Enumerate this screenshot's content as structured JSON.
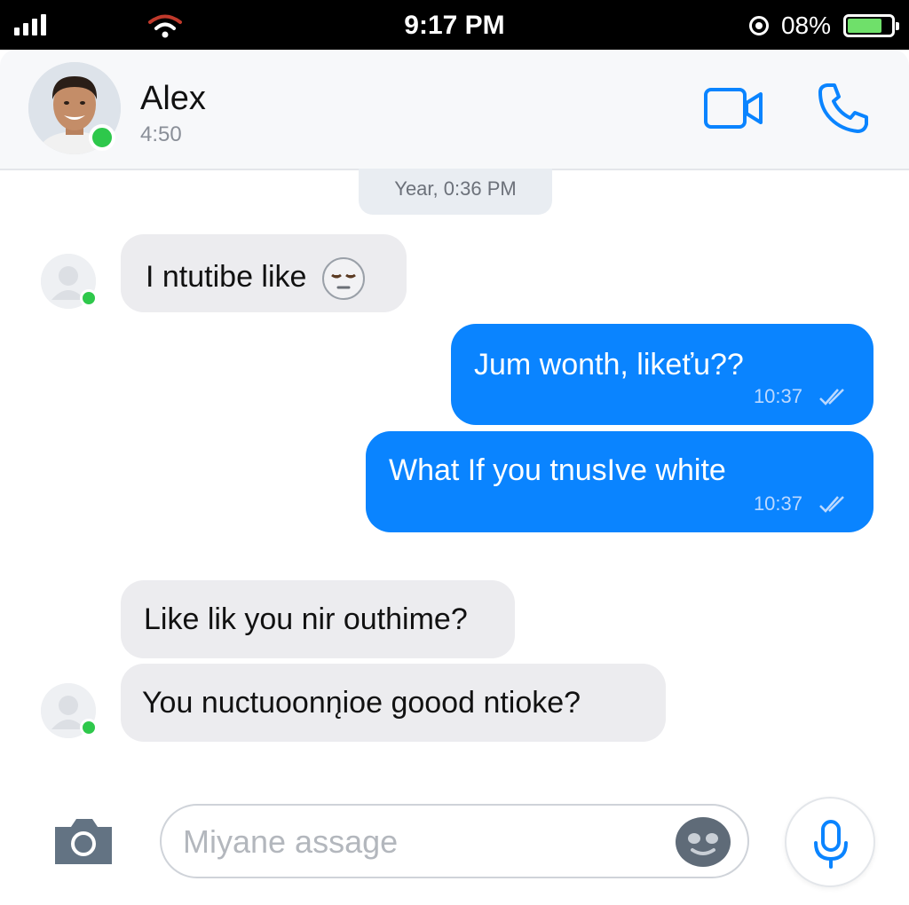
{
  "status_bar": {
    "time": "9:17 PM",
    "battery_percent_label": "08%",
    "battery_level": 0.08,
    "icons": [
      "signal-icon",
      "wifi-icon",
      "rotation-lock-icon",
      "battery-icon"
    ]
  },
  "header": {
    "contact_name": "Alex",
    "contact_sub": "4:50",
    "online": true,
    "icons": [
      "video-call-icon",
      "phone-call-icon"
    ]
  },
  "date_separator": "Year, 0:36 PM",
  "messages": [
    {
      "direction": "incoming",
      "text": "I ntutibe like",
      "emoji": "sleepy-face-emoji"
    },
    {
      "direction": "outgoing",
      "text": "Jum wonth, likeťu??",
      "time": "10:37",
      "status": "read"
    },
    {
      "direction": "outgoing",
      "text": "What If you tnusIve white",
      "time": "10:37",
      "status": "read"
    },
    {
      "direction": "incoming",
      "text": "Like lik you nir outhime?"
    },
    {
      "direction": "incoming",
      "text": "You nuctuoonn̨ioe goood ntioke?"
    }
  ],
  "composer": {
    "placeholder": "Miyane assage",
    "icons": [
      "camera-icon",
      "emoji-icon",
      "microphone-icon"
    ]
  },
  "colors": {
    "accent": "#0a84ff",
    "incoming_bubble": "#ececef",
    "online": "#2ec84b",
    "status_bar_bg": "#000000"
  }
}
